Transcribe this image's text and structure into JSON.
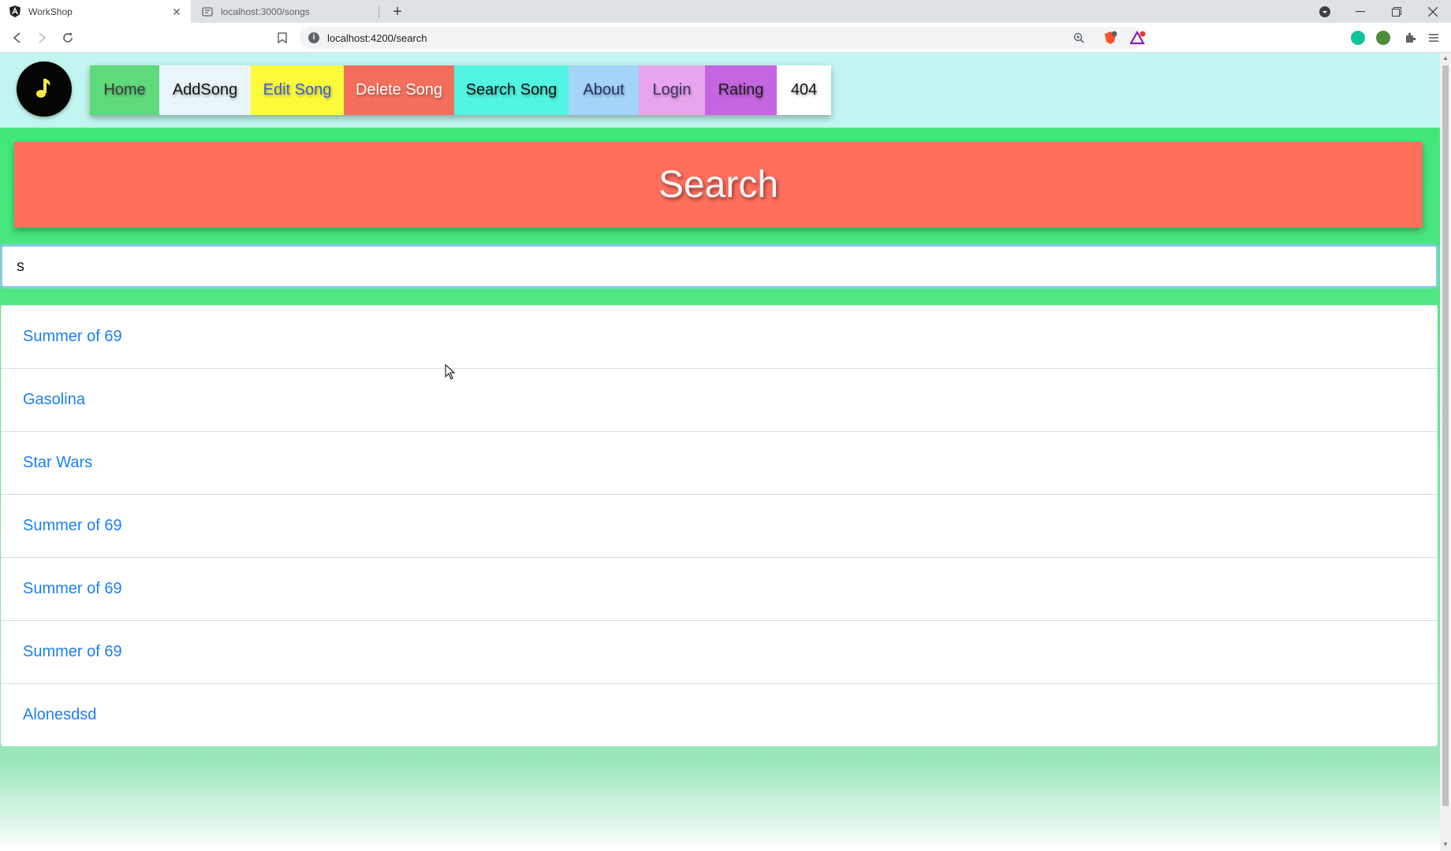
{
  "browser": {
    "tabs": [
      {
        "title": "WorkShop",
        "active": true
      },
      {
        "title": "localhost:3000/songs",
        "active": false
      }
    ],
    "url": "localhost:4200/search",
    "new_tab_icon": "plus-icon"
  },
  "app": {
    "logo_icon": "music-note-icon",
    "nav": [
      {
        "label": "Home",
        "bg": "#5fd97b",
        "color": "#3a3a3a"
      },
      {
        "label": "AddSong",
        "bg": "#e9f5f9",
        "color": "#111111"
      },
      {
        "label": "Edit Song",
        "bg": "#fbfb3a",
        "color": "#3b5bd8"
      },
      {
        "label": "Delete Song",
        "bg": "#f36f5c",
        "color": "#ffffff"
      },
      {
        "label": "Search Song",
        "bg": "#52f5e2",
        "color": "#111111"
      },
      {
        "label": "About",
        "bg": "#a4d4f7",
        "color": "#27306b"
      },
      {
        "label": "Login",
        "bg": "#e8a5ec",
        "color": "#3a3060"
      },
      {
        "label": "Rating",
        "bg": "#c565e2",
        "color": "#1d1d1d"
      },
      {
        "label": "404",
        "bg": "#ffffff",
        "color": "#111111"
      }
    ],
    "title": "Search",
    "search_value": "s",
    "results": [
      "Summer of 69",
      "Gasolina",
      "Star Wars",
      "Summer of 69",
      "Summer of 69",
      "Summer of 69",
      "Alonesdsd"
    ]
  },
  "colors": {
    "link": "#1a7ff5",
    "banner": "#ff6f5c",
    "header_bg": "#c2f5ef"
  }
}
